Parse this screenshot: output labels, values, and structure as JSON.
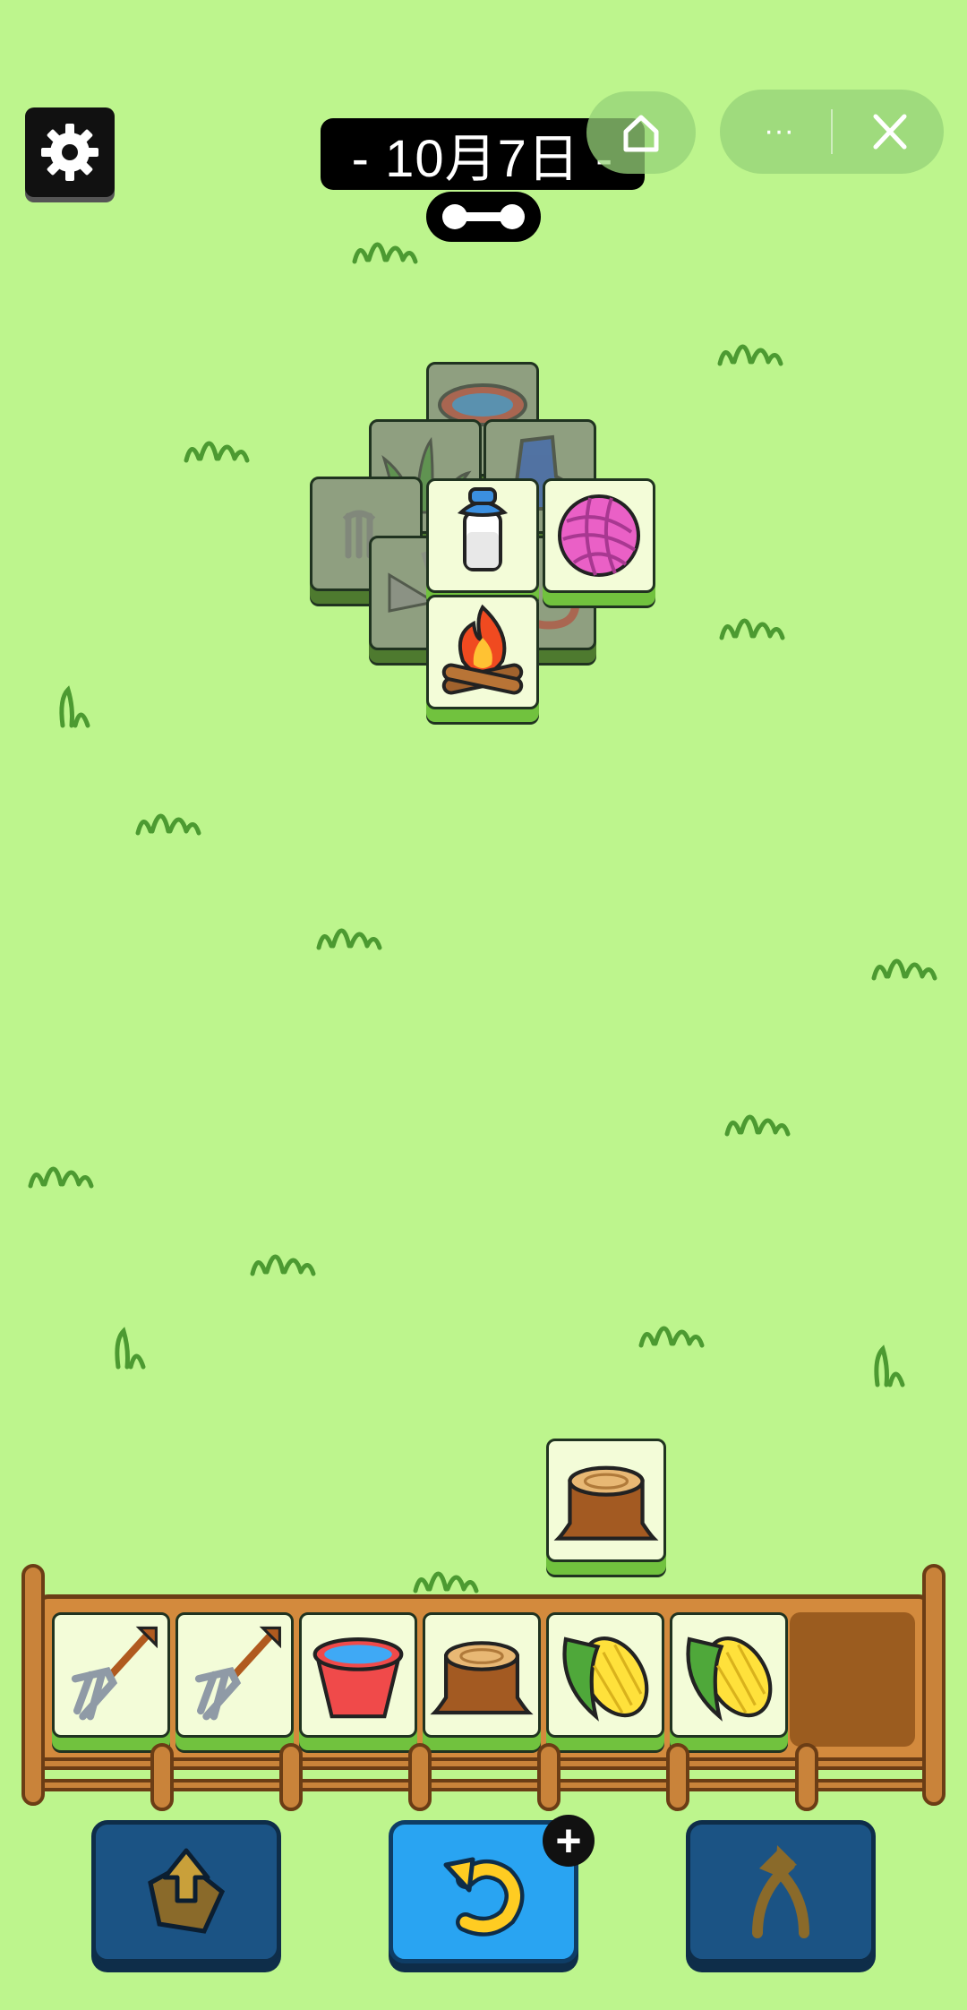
{
  "header": {
    "date_label": "- 10月7日 -",
    "settings_icon": "gear-icon",
    "key_icon": "dumbbell-key-icon"
  },
  "mini_program": {
    "home_icon": "home-icon",
    "more_label": "···",
    "close_icon": "close-icon"
  },
  "board_tiles": [
    {
      "item": "water-bowl",
      "state": "covered"
    },
    {
      "item": "grass",
      "state": "covered"
    },
    {
      "item": "blue-boot",
      "state": "covered"
    },
    {
      "item": "pitchfork",
      "state": "covered"
    },
    {
      "item": "shears",
      "state": "covered"
    },
    {
      "item": "red-rope",
      "state": "covered"
    },
    {
      "item": "milk-bottle",
      "state": "open"
    },
    {
      "item": "yarn-ball",
      "state": "open"
    },
    {
      "item": "campfire",
      "state": "open"
    }
  ],
  "floating_tile": {
    "item": "tree-stump"
  },
  "tray": {
    "slots": [
      "pitchfork",
      "pitchfork",
      "water-bucket",
      "tree-stump",
      "corn",
      "corn"
    ],
    "capacity": 7
  },
  "actions": [
    {
      "name": "move-out",
      "icon": "tile-up-arrow-icon"
    },
    {
      "name": "undo",
      "icon": "undo-arrow-icon",
      "badge": "+"
    },
    {
      "name": "shuffle",
      "icon": "shuffle-arrows-icon"
    }
  ],
  "colors": {
    "background": "#bdf58d",
    "tile_face": "#f3fcd8",
    "tile_base": "#71c23e",
    "button_blue": "#1b5384",
    "button_active": "#29a4f2",
    "tray_wood": "#d38a3d"
  }
}
